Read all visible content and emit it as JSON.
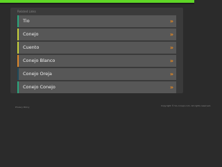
{
  "colors": {
    "top_bar": "#5ed626",
    "background": "#2b2b2b",
    "panel": "#3a3a3a",
    "item_background": "#575757",
    "arrow": "#f08c1e"
  },
  "panel": {
    "title": "Related Links"
  },
  "links": [
    {
      "label": "Tio",
      "arrow": "»",
      "accent": "#2aa87e",
      "icon": "double-chevron-right-icon"
    },
    {
      "label": "Conejo",
      "arrow": "»",
      "accent": "#c9d33a",
      "icon": "double-chevron-right-icon"
    },
    {
      "label": "Cuento",
      "arrow": "»",
      "accent": "#c9d33a",
      "icon": "double-chevron-right-icon"
    },
    {
      "label": "Conejo Blanco",
      "arrow": "»",
      "accent": "#e0892a",
      "icon": "double-chevron-right-icon"
    },
    {
      "label": "Conejo Oreja",
      "arrow": "»",
      "accent": "#1e4a5a",
      "icon": "double-chevron-right-icon"
    },
    {
      "label": "Conejo Conejo",
      "arrow": "»",
      "accent": "#2aa87e",
      "icon": "double-chevron-right-icon"
    }
  ],
  "footer": {
    "privacy": "Privacy Policy",
    "copyright": "Copyright © tio-conejo.com. All rights reserved."
  }
}
